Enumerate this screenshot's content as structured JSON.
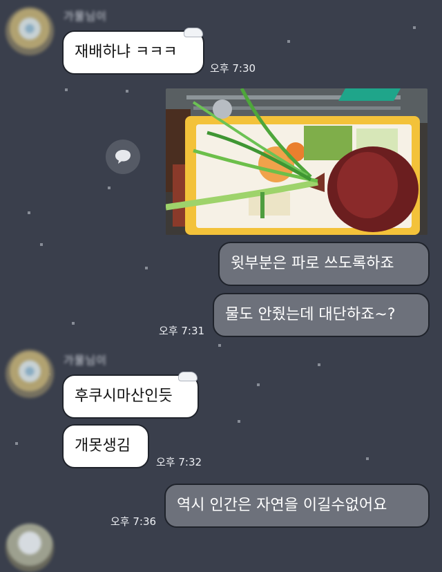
{
  "chat": {
    "sender_name": "가물님이",
    "messages": [
      {
        "text": "재배하냐 ㅋㅋㅋ",
        "time": "오후 7:30"
      },
      {
        "text": "윗부분은 파로 쓰도록하죠"
      },
      {
        "text": "물도 안줬는데 대단하죠~?",
        "time": "오후 7:31"
      },
      {
        "text": "후쿠시마산인듯"
      },
      {
        "text": "개못생김",
        "time": "오후 7:32"
      },
      {
        "text": "역시 인간은 자연을 이길수없어요",
        "time": "오후 7:36"
      }
    ],
    "photo": {
      "subject": "onion-with-green-sprouts"
    },
    "colors": {
      "background": "#3a3f4c",
      "incoming": "#ffffff",
      "outgoing": "#6d717b"
    }
  }
}
